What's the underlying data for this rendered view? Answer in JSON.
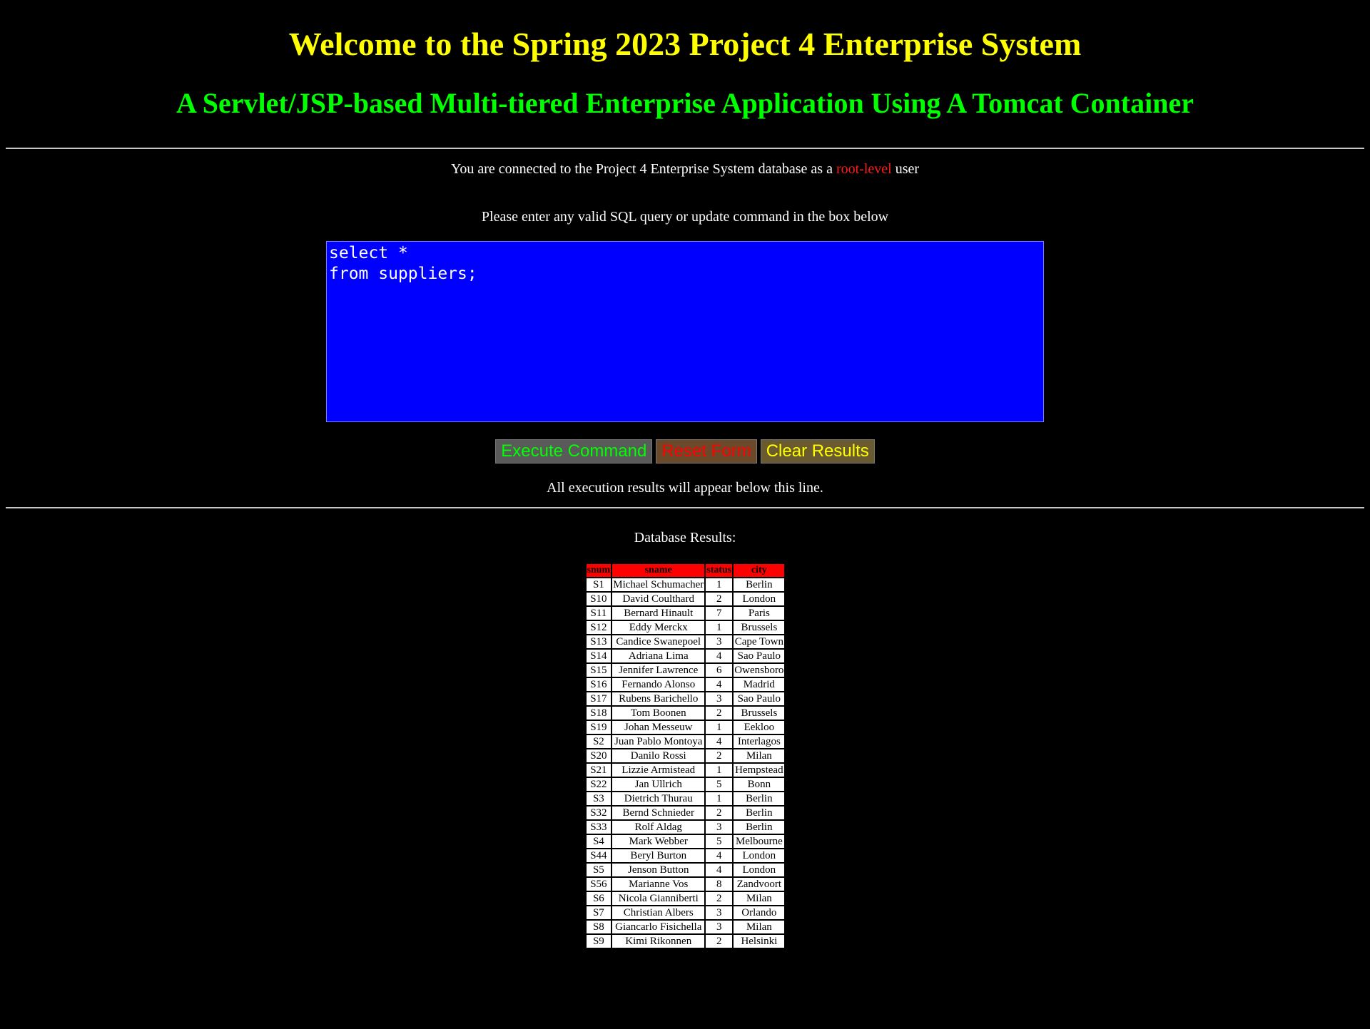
{
  "header": {
    "title": "Welcome to the Spring 2023 Project 4 Enterprise System",
    "subtitle": "A Servlet/JSP-based Multi-tiered Enterprise Application Using A Tomcat Container"
  },
  "connection": {
    "prefix": "You are connected to the Project 4 Enterprise System database as a ",
    "level": "root-level",
    "suffix": " user"
  },
  "prompt": "Please enter any valid SQL query or update command in the box below",
  "query": {
    "value": "select *\nfrom suppliers;"
  },
  "buttons": {
    "execute": "Execute Command",
    "reset": "Reset Form",
    "clear": "Clear Results"
  },
  "results_note": "All execution results will appear below this line.",
  "results_title": "Database Results:",
  "results_table": {
    "columns": [
      "snum",
      "sname",
      "status",
      "city"
    ],
    "rows": [
      [
        "S1",
        "Michael Schumacher",
        "1",
        "Berlin"
      ],
      [
        "S10",
        "David Coulthard",
        "2",
        "London"
      ],
      [
        "S11",
        "Bernard Hinault",
        "7",
        "Paris"
      ],
      [
        "S12",
        "Eddy Merckx",
        "1",
        "Brussels"
      ],
      [
        "S13",
        "Candice Swanepoel",
        "3",
        "Cape Town"
      ],
      [
        "S14",
        "Adriana Lima",
        "4",
        "Sao Paulo"
      ],
      [
        "S15",
        "Jennifer Lawrence",
        "6",
        "Owensboro"
      ],
      [
        "S16",
        "Fernando Alonso",
        "4",
        "Madrid"
      ],
      [
        "S17",
        "Rubens Barichello",
        "3",
        "Sao Paulo"
      ],
      [
        "S18",
        "Tom Boonen",
        "2",
        "Brussels"
      ],
      [
        "S19",
        "Johan Messeuw",
        "1",
        "Eekloo"
      ],
      [
        "S2",
        "Juan Pablo Montoya",
        "4",
        "Interlagos"
      ],
      [
        "S20",
        "Danilo Rossi",
        "2",
        "Milan"
      ],
      [
        "S21",
        "Lizzie Armistead",
        "1",
        "Hempstead"
      ],
      [
        "S22",
        "Jan Ullrich",
        "5",
        "Bonn"
      ],
      [
        "S3",
        "Dietrich Thurau",
        "1",
        "Berlin"
      ],
      [
        "S32",
        "Bernd Schnieder",
        "2",
        "Berlin"
      ],
      [
        "S33",
        "Rolf Aldag",
        "3",
        "Berlin"
      ],
      [
        "S4",
        "Mark Webber",
        "5",
        "Melbourne"
      ],
      [
        "S44",
        "Beryl Burton",
        "4",
        "London"
      ],
      [
        "S5",
        "Jenson Button",
        "4",
        "London"
      ],
      [
        "S56",
        "Marianne Vos",
        "8",
        "Zandvoort"
      ],
      [
        "S6",
        "Nicola Gianniberti",
        "2",
        "Milan"
      ],
      [
        "S7",
        "Christian Albers",
        "3",
        "Orlando"
      ],
      [
        "S8",
        "Giancarlo Fisichella",
        "3",
        "Milan"
      ],
      [
        "S9",
        "Kimi Rikonnen",
        "2",
        "Helsinki"
      ]
    ]
  },
  "colors": {
    "background": "#000000",
    "title": "#ffff00",
    "subtitle": "#00ff00",
    "root_level": "#ff1a1a",
    "query_box": "#0000ff",
    "table_header": "#ff0000"
  }
}
